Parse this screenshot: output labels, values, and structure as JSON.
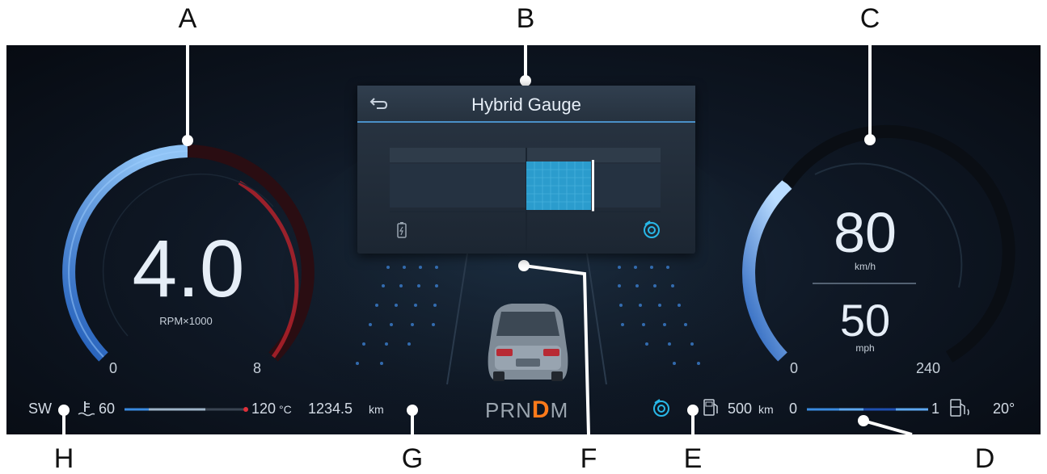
{
  "callouts": [
    "A",
    "B",
    "C",
    "D",
    "E",
    "F",
    "G",
    "H"
  ],
  "tachometer": {
    "value": "4.0",
    "unit": "RPM×1000",
    "min": "0",
    "max": "8"
  },
  "speedometer": {
    "speed_kmh": "80",
    "unit_kmh": "km/h",
    "speed_mph": "50",
    "unit_mph": "mph",
    "min": "0",
    "max": "240"
  },
  "hybrid_gauge": {
    "title": "Hybrid Gauge",
    "back_icon": "back-arrow-icon",
    "left_icon": "battery-icon",
    "right_icon": "engine-icon"
  },
  "status_bar": {
    "sw": "SW",
    "temp_min": "60",
    "temp_max": "120",
    "temp_unit": "°C",
    "odometer": "1234.5",
    "odometer_unit": "km",
    "gear_p": "P",
    "gear_r": "R",
    "gear_n": "N",
    "gear_d": "D",
    "gear_m": "M",
    "range": "500",
    "range_unit": "km",
    "fuel_min": "0",
    "fuel_max": "1",
    "outside_temp": "20°"
  },
  "colors": {
    "accent_blue": "#3a8be0",
    "accent_cyan": "#29b8e8",
    "gear_active": "#ff7a1a",
    "redline": "#b3222b"
  }
}
